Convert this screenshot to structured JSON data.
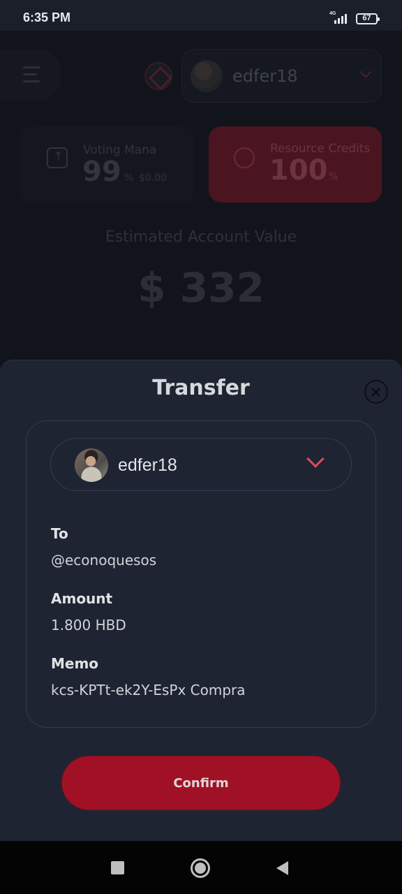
{
  "status_bar": {
    "time": "6:35 PM",
    "network": "4G",
    "battery": "67"
  },
  "background": {
    "account_name": "edfer18",
    "voting_mana": {
      "label": "Voting Mana",
      "value": "99",
      "unit": "%",
      "usd": "$0.00"
    },
    "resource_credits": {
      "label": "Resource Credits",
      "value": "100",
      "unit": "%"
    },
    "estimated_label": "Estimated Account Value",
    "estimated_value": "$ 332"
  },
  "transfer": {
    "title": "Transfer",
    "account": "edfer18",
    "to_label": "To",
    "to_value": "@econoquesos",
    "amount_label": "Amount",
    "amount_value": "1.800 HBD",
    "memo_label": "Memo",
    "memo_value": "kcs-KPTt-ek2Y-EsPx Compra",
    "confirm_label": "Confirm"
  },
  "colors": {
    "accent": "#a11126",
    "sheet_bg": "#1f2432",
    "chevron": "#d5505e"
  }
}
